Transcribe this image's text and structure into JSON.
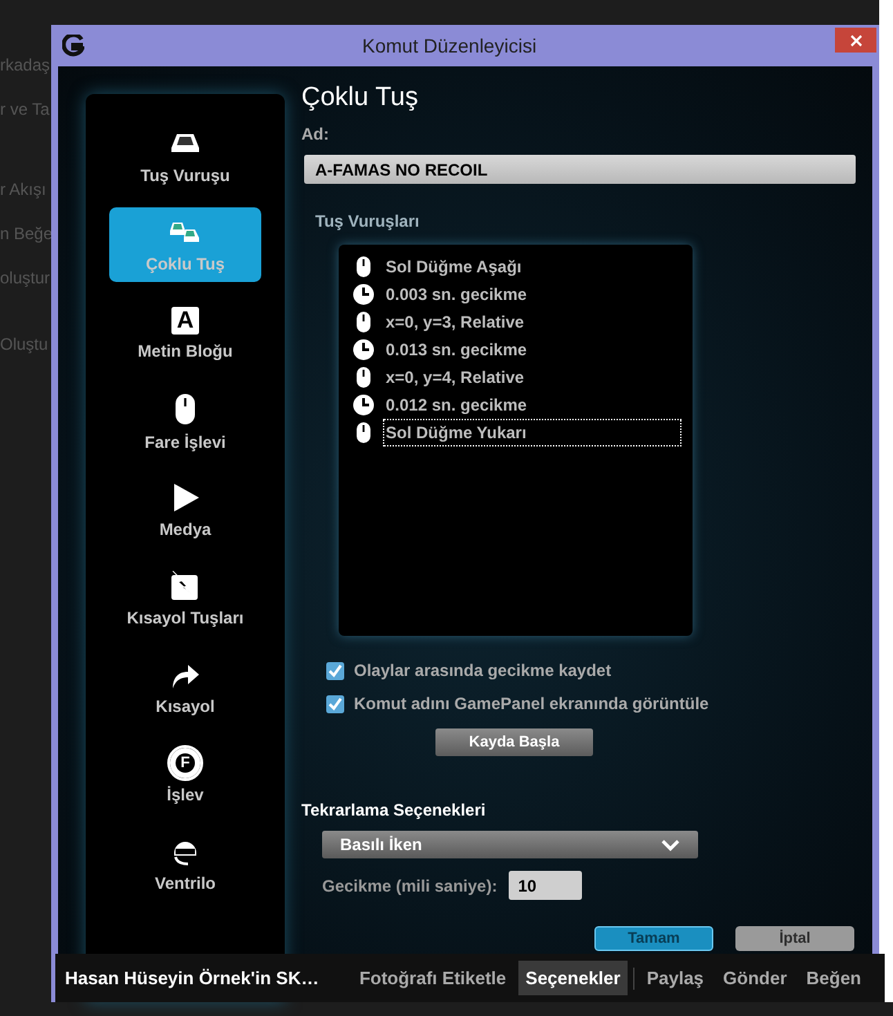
{
  "background_fragments": [
    "rkadaş",
    "r ve Ta",
    "r Akışı",
    "n Beğe",
    "oluştur",
    "Oluştu"
  ],
  "window": {
    "title": "Komut Düzenleyicisi"
  },
  "sidebar": {
    "items": [
      {
        "label": "Tuş Vuruşu",
        "kind": "key",
        "selected": false
      },
      {
        "label": "Çoklu Tuş",
        "kind": "multikey",
        "selected": true
      },
      {
        "label": "Metin Bloğu",
        "kind": "text",
        "glyph": "A",
        "selected": false
      },
      {
        "label": "Fare İşlevi",
        "kind": "mouse",
        "selected": false
      },
      {
        "label": "Medya",
        "kind": "media",
        "selected": false
      },
      {
        "label": "Kısayol Tuşları",
        "kind": "hotkey",
        "selected": false
      },
      {
        "label": "Kısayol",
        "kind": "shortcut",
        "selected": false
      },
      {
        "label": "İşlev",
        "kind": "function",
        "glyph": "F",
        "selected": false
      },
      {
        "label": "Ventrilo",
        "kind": "headset",
        "selected": false
      }
    ]
  },
  "editor": {
    "title": "Çoklu Tuş",
    "name_label": "Ad:",
    "name_value": "A-FAMAS NO RECOIL",
    "keystrokes_label": "Tuş Vuruşları",
    "events": [
      {
        "kind": "mouse",
        "text": "Sol Düğme Aşağı",
        "selected": false
      },
      {
        "kind": "delay",
        "text": "0.003 sn. gecikme",
        "selected": false
      },
      {
        "kind": "mouse",
        "text": "x=0, y=3, Relative",
        "selected": false
      },
      {
        "kind": "delay",
        "text": "0.013 sn. gecikme",
        "selected": false
      },
      {
        "kind": "mouse",
        "text": "x=0, y=4, Relative",
        "selected": false
      },
      {
        "kind": "delay",
        "text": "0.012 sn. gecikme",
        "selected": false
      },
      {
        "kind": "mouse",
        "text": "Sol Düğme Yukarı",
        "selected": true
      }
    ],
    "options": [
      {
        "label": "Olaylar arasında gecikme kaydet",
        "checked": true
      },
      {
        "label": "Komut adını GamePanel ekranında görüntüle",
        "checked": true
      }
    ],
    "record_button": "Kayda Başla",
    "repeat": {
      "title": "Tekrarlama Seçenekleri",
      "dropdown_value": "Basılı İken",
      "delay_label": "Gecikme (mili saniye):",
      "delay_value": "10"
    },
    "buttons": [
      {
        "label": "Tamam",
        "kind": "primary"
      },
      {
        "label": "İptal",
        "kind": "secondary"
      }
    ]
  },
  "photo_bar": {
    "owner": "Hasan Hüseyin Örnek'in SK…",
    "actions": [
      {
        "label": "Fotoğrafı Etiketle",
        "selected": false
      },
      {
        "label": "Seçenekler",
        "selected": true
      },
      {
        "label": "Paylaş",
        "selected": false
      },
      {
        "label": "Gönder",
        "selected": false
      },
      {
        "label": "Beğen",
        "selected": false
      }
    ]
  }
}
